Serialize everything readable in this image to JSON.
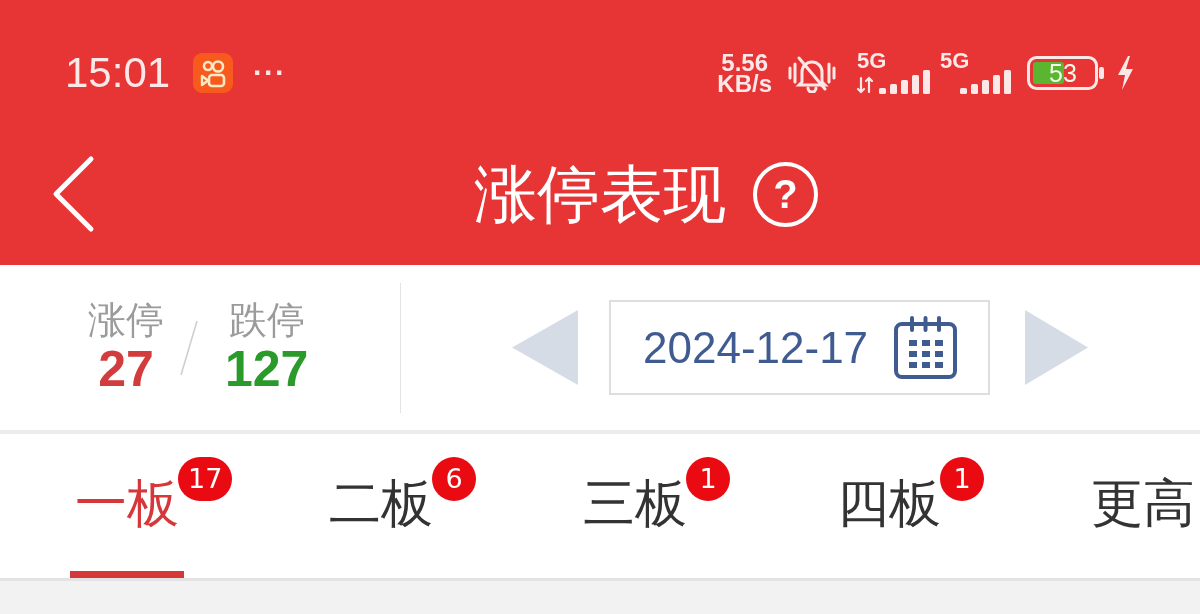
{
  "status_bar": {
    "time": "15:01",
    "more": "···",
    "net_speed": {
      "value": "5.56",
      "unit": "KB/s"
    },
    "signals": [
      {
        "label": "5G",
        "kind": "data"
      },
      {
        "label": "5G",
        "kind": "plain"
      }
    ],
    "battery": "53"
  },
  "header": {
    "title": "涨停表现",
    "help": "?"
  },
  "stats": [
    {
      "label": "涨停",
      "value": "27",
      "kind": "up"
    },
    {
      "label": "跌停",
      "value": "127",
      "kind": "down"
    }
  ],
  "date_nav": {
    "date": "2024-12-17"
  },
  "tabs": [
    {
      "label": "一板",
      "badge": "17",
      "selected": true
    },
    {
      "label": "二板",
      "badge": "6",
      "selected": false
    },
    {
      "label": "三板",
      "badge": "1",
      "selected": false
    },
    {
      "label": "四板",
      "badge": "1",
      "selected": false
    },
    {
      "label": "更高",
      "selected": false
    }
  ]
}
